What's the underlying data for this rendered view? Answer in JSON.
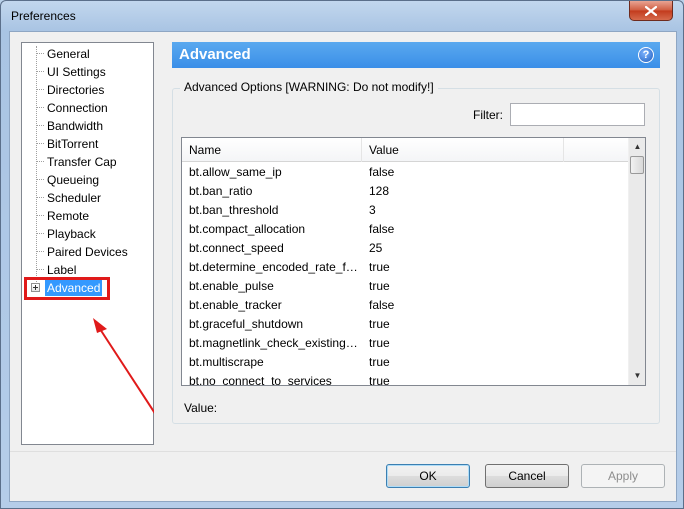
{
  "window": {
    "title": "Preferences"
  },
  "tree": {
    "items": [
      {
        "label": "General"
      },
      {
        "label": "UI Settings"
      },
      {
        "label": "Directories"
      },
      {
        "label": "Connection"
      },
      {
        "label": "Bandwidth"
      },
      {
        "label": "BitTorrent"
      },
      {
        "label": "Transfer Cap"
      },
      {
        "label": "Queueing"
      },
      {
        "label": "Scheduler"
      },
      {
        "label": "Remote"
      },
      {
        "label": "Playback"
      },
      {
        "label": "Paired Devices"
      },
      {
        "label": "Label"
      },
      {
        "label": "Advanced",
        "selected": true,
        "expandable": true
      }
    ]
  },
  "panel": {
    "title": "Advanced",
    "help_icon": "help-icon",
    "group_label": "Advanced Options [WARNING: Do not modify!]",
    "filter_label": "Filter:",
    "filter_value": "",
    "columns": [
      "Name",
      "Value"
    ],
    "rows": [
      {
        "name": "bt.allow_same_ip",
        "value": "false"
      },
      {
        "name": "bt.ban_ratio",
        "value": "128"
      },
      {
        "name": "bt.ban_threshold",
        "value": "3"
      },
      {
        "name": "bt.compact_allocation",
        "value": "false"
      },
      {
        "name": "bt.connect_speed",
        "value": "25"
      },
      {
        "name": "bt.determine_encoded_rate_fo...",
        "value": "true"
      },
      {
        "name": "bt.enable_pulse",
        "value": "true"
      },
      {
        "name": "bt.enable_tracker",
        "value": "false"
      },
      {
        "name": "bt.graceful_shutdown",
        "value": "true"
      },
      {
        "name": "bt.magnetlink_check_existing_...",
        "value": "true"
      },
      {
        "name": "bt.multiscrape",
        "value": "true"
      },
      {
        "name": "bt.no_connect_to_services",
        "value": "true"
      }
    ],
    "value_label": "Value:"
  },
  "buttons": {
    "ok": "OK",
    "cancel": "Cancel",
    "apply": "Apply"
  },
  "colors": {
    "highlight": "#e01a1a",
    "header": "#3a8ee8",
    "selection": "#3399ff"
  }
}
